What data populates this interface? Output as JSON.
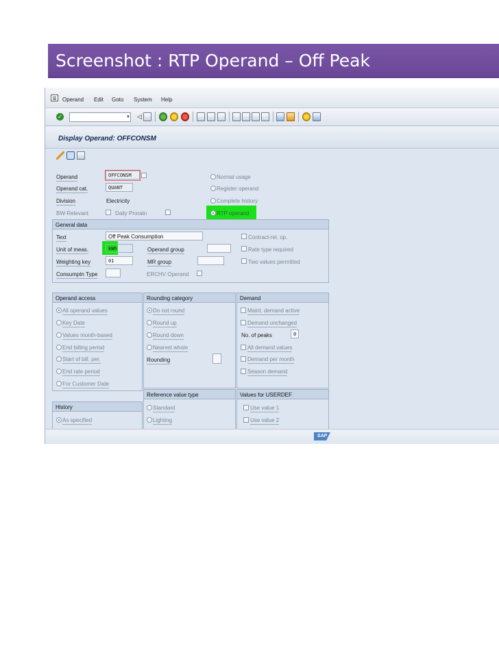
{
  "slide": {
    "title": "Screenshot : RTP Operand – Off Peak"
  },
  "menu": [
    "Operand",
    "Edit",
    "Goto",
    "System",
    "Help"
  ],
  "screen": {
    "title": "Display Operand: OFFCONSM"
  },
  "header": {
    "operand_label": "Operand",
    "operand_value": "OFFCONSM",
    "operand_cat_label": "Operand cat.",
    "operand_cat_value": "QUANT",
    "division_label": "Division",
    "division_value": "Electricity",
    "bw_relevant_label": "BW-Relevant",
    "daily_proratn_label": "Daily Proratn",
    "usage_options": [
      "Normal usage",
      "Register operand",
      "Complete history",
      "RTP operand"
    ],
    "usage_selected": "RTP operand"
  },
  "general_data": {
    "title": "General data",
    "text_label": "Text",
    "text_value": "Off Peak Consumption",
    "unit_label": "Unit of meas.",
    "unit_value": "kWh",
    "operand_group_label": "Operand group",
    "weighting_label": "Weighting key",
    "weighting_value": "01",
    "mr_group_label": "MR group",
    "consumptn_type_label": "Consumptn Type",
    "erchv_label": "ERCHV Operand",
    "contract_rel_label": "Contract-rel. op.",
    "rate_type_label": "Rate type required",
    "two_values_label": "Two values permitted"
  },
  "operand_access": {
    "title": "Operand access",
    "options": [
      "All operand values",
      "Key Date",
      "Values month-based",
      "End billing period",
      "Start of bill. per.",
      "End rate period",
      "For Customer Date"
    ],
    "selected": "All operand values"
  },
  "rounding": {
    "title": "Rounding category",
    "options": [
      "Do not round",
      "Round up",
      "Round down",
      "Nearest whole"
    ],
    "selected": "Do not round",
    "rounding_label": "Rounding"
  },
  "demand": {
    "title": "Demand",
    "maint_label": "Maint. demand active",
    "unchanged_label": "Demand unchanged",
    "peaks_label": "No. of peaks",
    "peaks_value": "0",
    "all_values_label": "All demand values",
    "per_month_label": "Demand per month",
    "season_label": "Season demand"
  },
  "history": {
    "title": "History",
    "options": [
      "As specified"
    ],
    "selected": "As specified"
  },
  "reference_value": {
    "title": "Reference value type",
    "options": [
      "Standard",
      "Lighting"
    ]
  },
  "userdef": {
    "title": "Values for USERDEF",
    "options": [
      "Use value 1",
      "Use value 2"
    ]
  },
  "branding": {
    "logo": "SAP"
  },
  "colors": {
    "banner": "#6a4797",
    "highlight": "#19e019",
    "group_header": "#c6d4e6"
  }
}
